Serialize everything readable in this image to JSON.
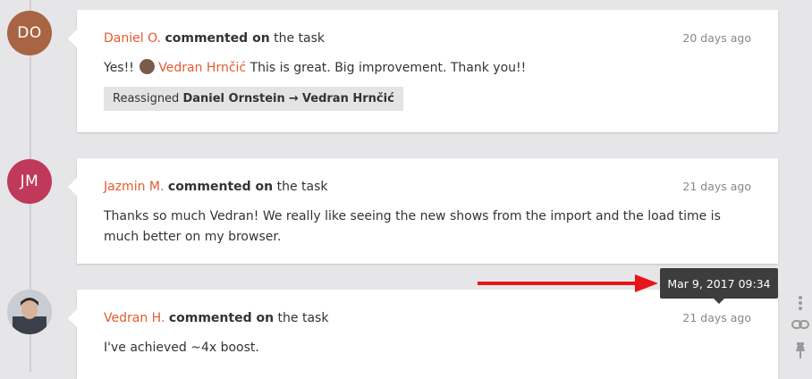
{
  "comments": [
    {
      "avatar_initials": "DO",
      "avatar_color": "#a76543",
      "author": "Daniel O.",
      "action": "commented on",
      "target": "the task",
      "time": "20 days ago",
      "body_prefix": "Yes!!",
      "mention": "Vedran Hrnčić",
      "body_suffix": "This is great. Big improvement. Thank you!!",
      "reassign": {
        "label": "Reassigned",
        "from": "Daniel Ornstein",
        "arrow": "→",
        "to": "Vedran Hrnčić"
      }
    },
    {
      "avatar_initials": "JM",
      "avatar_color": "#c0395a",
      "author": "Jazmin M.",
      "action": "commented on",
      "target": "the task",
      "time": "21 days ago",
      "body": "Thanks so much Vedran! We really like seeing the new shows from the import and the load time is much better on my browser."
    },
    {
      "author": "Vedran H.",
      "action": "commented on",
      "target": "the task",
      "time": "21 days ago",
      "body": "I've achieved ~4x boost."
    }
  ],
  "tooltip": "Mar 9, 2017 09:34",
  "colors": {
    "accent": "#e35b2f",
    "annotation_arrow": "#e8141b"
  },
  "icons": [
    "more-vertical-icon",
    "link-icon",
    "pin-icon"
  ]
}
